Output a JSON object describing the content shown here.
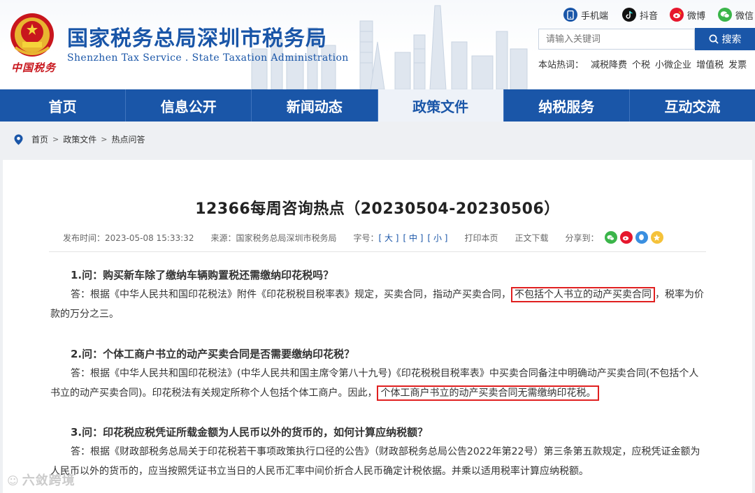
{
  "header": {
    "site_title": "国家税务总局深圳市税务局",
    "site_subtitle": "Shenzhen Tax Service . State Taxation Administration",
    "logo_text": "中国税务",
    "social": [
      {
        "label": "手机端",
        "icon": "mobile-icon",
        "color": "#1a56a8"
      },
      {
        "label": "抖音",
        "icon": "douyin-icon",
        "color": "#111111"
      },
      {
        "label": "微博",
        "icon": "weibo-icon",
        "color": "#e6162d"
      },
      {
        "label": "微信",
        "icon": "wechat-icon",
        "color": "#3bb54a"
      }
    ],
    "search": {
      "placeholder": "请输入关键词",
      "button_label": "搜索"
    },
    "hotwords": {
      "label": "本站热词：",
      "items": [
        "减税降费",
        "个税",
        "小微企业",
        "增值税",
        "发票"
      ]
    }
  },
  "nav": {
    "items": [
      "首页",
      "信息公开",
      "新闻动态",
      "政策文件",
      "纳税服务",
      "互动交流"
    ],
    "active": "政策文件"
  },
  "breadcrumb": [
    "首页",
    "政策文件",
    "热点问答"
  ],
  "article": {
    "title": "12366每周咨询热点（20230504-20230506）",
    "meta": {
      "publish_time": "发布时间：2023-05-08 15:33:32",
      "source": "来源：国家税务总局深圳市税务局",
      "font_size_label": "字号：",
      "font_sizes": [
        "[ 大 ]",
        "[ 中 ]",
        "[ 小 ]"
      ],
      "print": "打印本页",
      "download": "正文下载",
      "share": "分享到："
    },
    "qa": [
      {
        "question": "1.问：购买新车除了缴纳车辆购置税还需缴纳印花税吗？",
        "answer_before": "答：根据《中华人民共和国印花税法》附件《印花税税目税率表》规定，买卖合同，指动产买卖合同，",
        "answer_highlight": "不包括个人书立的动产买卖合同",
        "answer_after": "，税率为价款的万分之三。"
      },
      {
        "question": "2.问：个体工商户书立的动产买卖合同是否需要缴纳印花税？",
        "answer_before": "答：根据《中华人民共和国印花税法》(中华人民共和国主席令第八十九号)《印花税税目税率表》中买卖合同备注中明确动产买卖合同(不包括个人书立的动产买卖合同)。印花税法有关规定所称个人包括个体工商户。因此，",
        "answer_highlight": "个体工商户书立的动产买卖合同无需缴纳印花税。",
        "answer_after": ""
      },
      {
        "question": "3.问：印花税应税凭证所载金额为人民币以外的货币的，如何计算应纳税额？",
        "answer_before": "答：根据《财政部税务总局关于印花税若干事项政策执行口径的公告》（财政部税务总局公告2022年第22号）第三条第五款规定，应税凭证金额为人民币以外的货币的，应当按照凭证书立当日的人民币汇率中间价折合人民币确定计税依据。并乘以适用税率计算应纳税额。",
        "answer_highlight": "",
        "answer_after": ""
      }
    ]
  },
  "watermark": "六敛跨境"
}
